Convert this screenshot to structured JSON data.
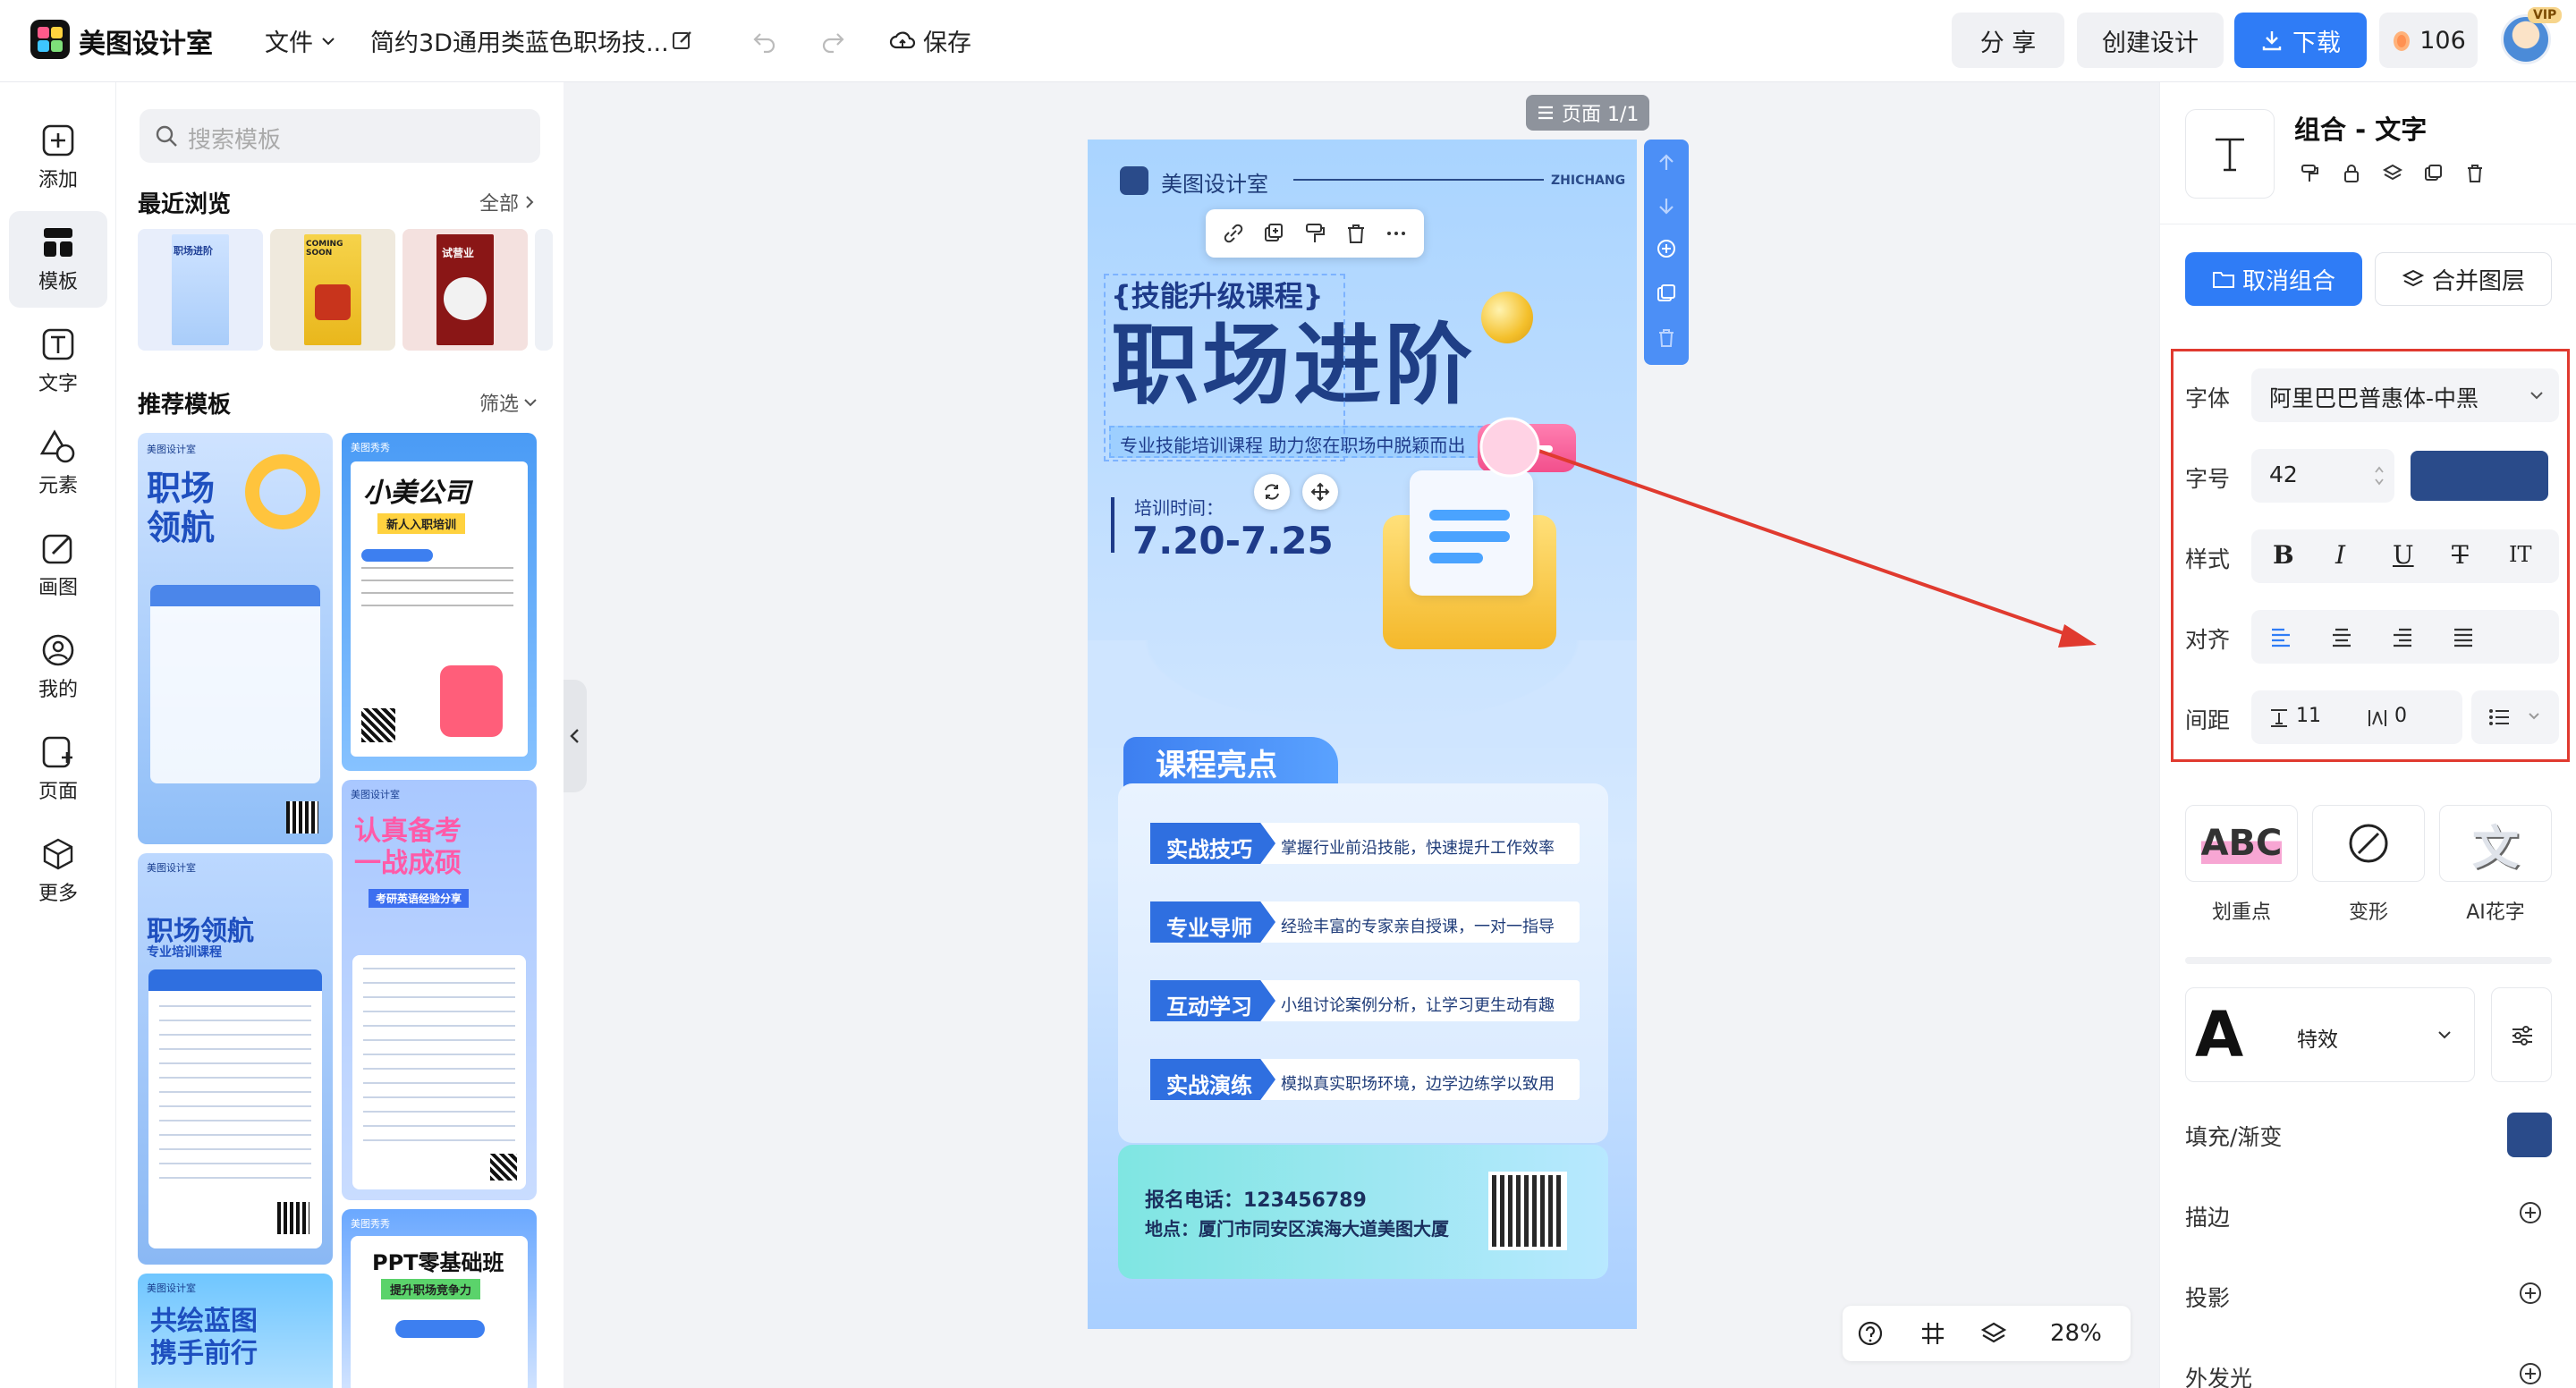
{
  "app": {
    "brand": "美图设计室"
  },
  "toolbar": {
    "file_menu": "文件",
    "doc_title": "简约3D通用类蓝色职场技...",
    "save": "保存",
    "share": "分 享",
    "create": "创建设计",
    "download": "下载",
    "credits": "106",
    "vip_badge": "VIP"
  },
  "rail": {
    "items": [
      {
        "label": "添加",
        "icon": "add-icon"
      },
      {
        "label": "模板",
        "icon": "template-icon"
      },
      {
        "label": "文字",
        "icon": "text-icon"
      },
      {
        "label": "元素",
        "icon": "shapes-icon"
      },
      {
        "label": "画图",
        "icon": "draw-icon"
      },
      {
        "label": "我的",
        "icon": "user-icon"
      },
      {
        "label": "页面",
        "icon": "page-icon"
      },
      {
        "label": "更多",
        "icon": "cube-icon"
      }
    ]
  },
  "left_panel": {
    "search_placeholder": "搜索模板",
    "recent_title": "最近浏览",
    "recent_all": "全部",
    "recommended_title": "推荐模板",
    "filter": "筛选",
    "recent_thumbs": [
      {
        "text": "职场进阶"
      },
      {
        "text": "COMING SOON"
      },
      {
        "text": "试营业"
      }
    ],
    "templates": [
      {
        "title": "职场领航",
        "tag": "美图设计室"
      },
      {
        "title": "小美公司",
        "subtitle": "新人入职培训",
        "tag": "美图秀秀"
      },
      {
        "title": "职场领航",
        "subtitle": "专业培训课程",
        "tag": "美图设计室"
      },
      {
        "title": "认真备考 一战成硕",
        "subtitle": "考研英语经验分享",
        "tag": "美图设计室"
      },
      {
        "title": "共绘蓝图 携手前行",
        "tag": "美图设计室"
      },
      {
        "title": "PPT零基础班",
        "subtitle": "提升职场竞争力",
        "tag": "美图秀秀"
      }
    ]
  },
  "canvas": {
    "page_indicator": "页面 1/1",
    "zoom": "28%"
  },
  "poster": {
    "brand": "美图设计室",
    "brand_en": "ZHICHANG",
    "tag": "{技能升级课程}",
    "headline": "职场进阶",
    "subline": "专业技能培训课程 助力您在职场中脱颖而出",
    "date_label": "培训时间：",
    "date": "7.20-7.25",
    "section_title": "课程亮点",
    "highlights": [
      {
        "label": "实战技巧",
        "desc": "掌握行业前沿技能，快速提升工作效率"
      },
      {
        "label": "专业导师",
        "desc": "经验丰富的专家亲自授课，一对一指导"
      },
      {
        "label": "互动学习",
        "desc": "小组讨论案例分析，让学习更生动有趣"
      },
      {
        "label": "实战演练",
        "desc": "模拟真实职场环境，边学边练学以致用"
      }
    ],
    "phone": "报名电话：123456789",
    "address": "地点：厦门市同安区滨海大道美图大厦"
  },
  "right_panel": {
    "element_name": "组合 - 文字",
    "ungroup": "取消组合",
    "merge": "合并图层",
    "font_label": "字体",
    "font_value": "阿里巴巴普惠体-中黑",
    "size_label": "字号",
    "size_value": "42",
    "text_color": "#2a4b8a",
    "style_label": "样式",
    "align_label": "对齐",
    "spacing_label": "间距",
    "line_spacing": "11",
    "letter_spacing": "0",
    "effects": [
      {
        "label": "划重点",
        "preview": "ABC"
      },
      {
        "label": "变形"
      },
      {
        "label": "AI花字",
        "preview": "文"
      }
    ],
    "effect_select": "特效",
    "fill_label": "填充/渐变",
    "fill_color": "#2a4b8a",
    "stroke_label": "描边",
    "shadow_label": "投影",
    "glow_label": "外发光"
  },
  "colors": {
    "accent": "#2f7cf6",
    "highlight_box": "#e03a2f"
  }
}
